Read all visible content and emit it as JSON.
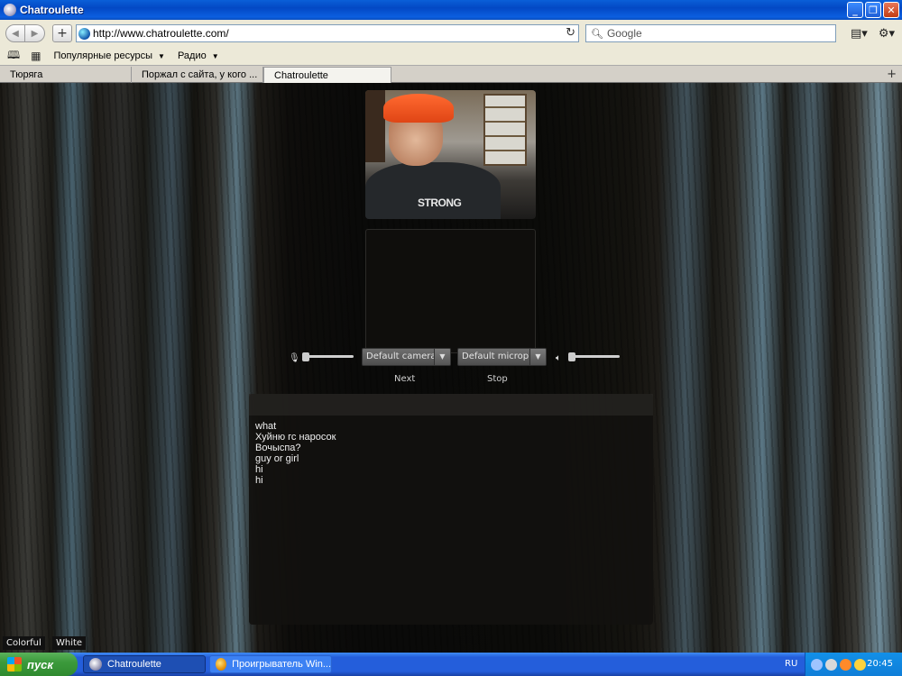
{
  "window": {
    "title": "Chatroulette"
  },
  "toolbar": {
    "back_icon": "back-arrow-icon",
    "forward_icon": "forward-arrow-icon",
    "url": "http://www.chatroulette.com/",
    "search_placeholder": "Google"
  },
  "bookmarks": {
    "items": [
      {
        "label": "Популярные ресурсы"
      },
      {
        "label": "Радио"
      }
    ]
  },
  "tabs": [
    {
      "label": "Тюряга"
    },
    {
      "label": "Поржал с сайта, у кого ..."
    },
    {
      "label": "Chatroulette"
    }
  ],
  "page": {
    "remote_video_shirt_text": "STRONG",
    "camera_select": "Default camera",
    "microphone_select": "Default micropho",
    "next_label": "Next",
    "stop_label": "Stop",
    "chat_messages": [
      "what",
      "Хуйню гс наросок",
      "Вочыспа?",
      "guy or girl",
      "hi",
      "hi"
    ],
    "theme_colorful": "Colorful",
    "theme_white": "White"
  },
  "taskbar": {
    "start_label": "пуск",
    "tasks": [
      {
        "label": "Chatroulette"
      },
      {
        "label": "Проигрыватель Win..."
      }
    ],
    "language": "RU",
    "clock": "20:45"
  }
}
